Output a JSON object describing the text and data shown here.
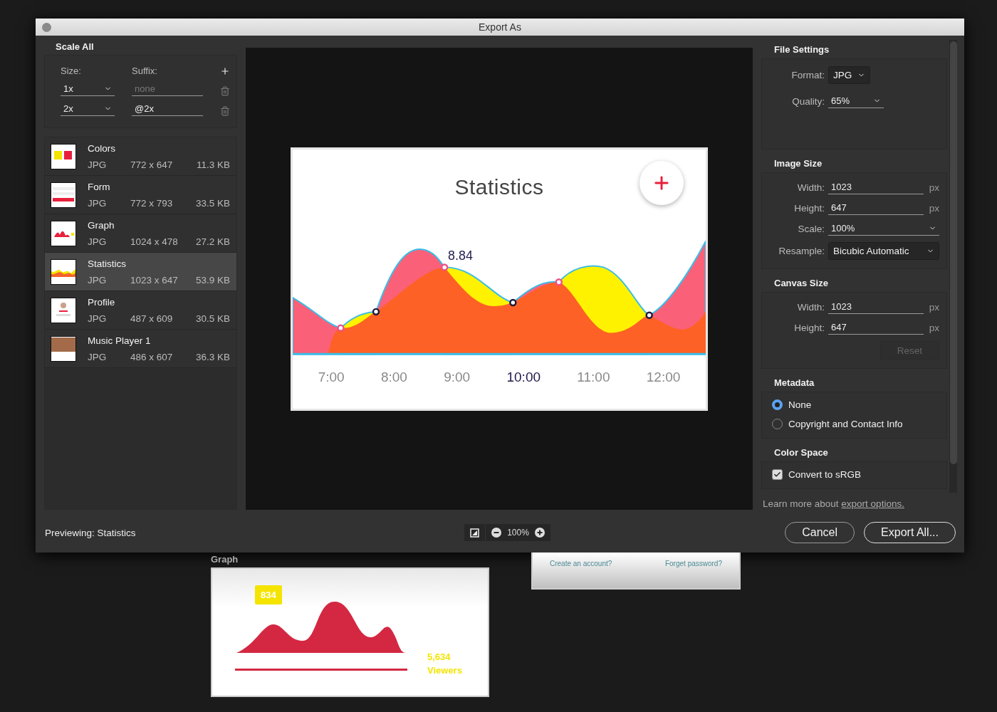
{
  "window": {
    "title": "Export As"
  },
  "scale_all": {
    "title": "Scale All",
    "size_label": "Size:",
    "suffix_label": "Suffix:",
    "rows": [
      {
        "size": "1x",
        "suffix": "",
        "suffix_placeholder": "none"
      },
      {
        "size": "2x",
        "suffix": "@2x",
        "suffix_placeholder": ""
      }
    ]
  },
  "assets": [
    {
      "name": "Colors",
      "format": "JPG",
      "dimensions": "772 x 647",
      "file_size": "11.3 KB",
      "selected": false,
      "kind": "swatches"
    },
    {
      "name": "Form",
      "format": "JPG",
      "dimensions": "772 x 793",
      "file_size": "33.5 KB",
      "selected": false,
      "kind": "form"
    },
    {
      "name": "Graph",
      "format": "JPG",
      "dimensions": "1024 x 478",
      "file_size": "27.2 KB",
      "selected": false,
      "kind": "graph"
    },
    {
      "name": "Statistics",
      "format": "JPG",
      "dimensions": "1023 x 647",
      "file_size": "53.9 KB",
      "selected": true,
      "kind": "chart"
    },
    {
      "name": "Profile",
      "format": "JPG",
      "dimensions": "487 x 609",
      "file_size": "30.5 KB",
      "selected": false,
      "kind": "profile"
    },
    {
      "name": "Music Player 1",
      "format": "JPG",
      "dimensions": "486 x 607",
      "file_size": "36.3 KB",
      "selected": false,
      "kind": "photo"
    }
  ],
  "preview": {
    "title": "Statistics",
    "value_label": "8.84",
    "times": [
      {
        "label": "7:00",
        "selected": false
      },
      {
        "label": "8:00",
        "selected": false
      },
      {
        "label": "9:00",
        "selected": false
      },
      {
        "label": "10:00",
        "selected": true
      },
      {
        "label": "11:00",
        "selected": false
      },
      {
        "label": "12:00",
        "selected": false
      }
    ]
  },
  "file_settings": {
    "title": "File Settings",
    "format_label": "Format:",
    "format": "JPG",
    "quality_label": "Quality:",
    "quality": "65%"
  },
  "image_size": {
    "title": "Image Size",
    "fields": [
      {
        "label": "Width:",
        "value": "1023",
        "unit": "px",
        "kind": "text"
      },
      {
        "label": "Height:",
        "value": "647",
        "unit": "px",
        "kind": "text"
      },
      {
        "label": "Scale:",
        "value": "100%",
        "kind": "dropdown"
      }
    ],
    "resample_label": "Resample:",
    "resample": "Bicubic Automatic"
  },
  "canvas_size": {
    "title": "Canvas Size",
    "fields": [
      {
        "label": "Width:",
        "value": "1023",
        "unit": "px"
      },
      {
        "label": "Height:",
        "value": "647",
        "unit": "px"
      }
    ],
    "reset": {
      "label": "Reset",
      "disabled": true
    }
  },
  "metadata": {
    "title": "Metadata",
    "options": [
      {
        "label": "None",
        "selected": true
      },
      {
        "label": "Copyright and Contact Info",
        "selected": false
      }
    ]
  },
  "color_space": {
    "title": "Color Space",
    "convert": {
      "label": "Convert to sRGB",
      "checked": true
    }
  },
  "learn_more": {
    "text": "Learn more about",
    "link": "export options."
  },
  "footer": {
    "previewing": "Previewing: Statistics",
    "zoom": "100%",
    "buttons": [
      {
        "label": "Cancel",
        "kind": "secondary"
      },
      {
        "label": "Export All...",
        "kind": "primary"
      }
    ]
  },
  "artboards": {
    "graph": {
      "label": "Graph",
      "badge": "834",
      "count": "5,634",
      "count_label": "Viewers"
    },
    "form": {
      "links": [
        "Create an account?",
        "Forget password?"
      ]
    }
  }
}
